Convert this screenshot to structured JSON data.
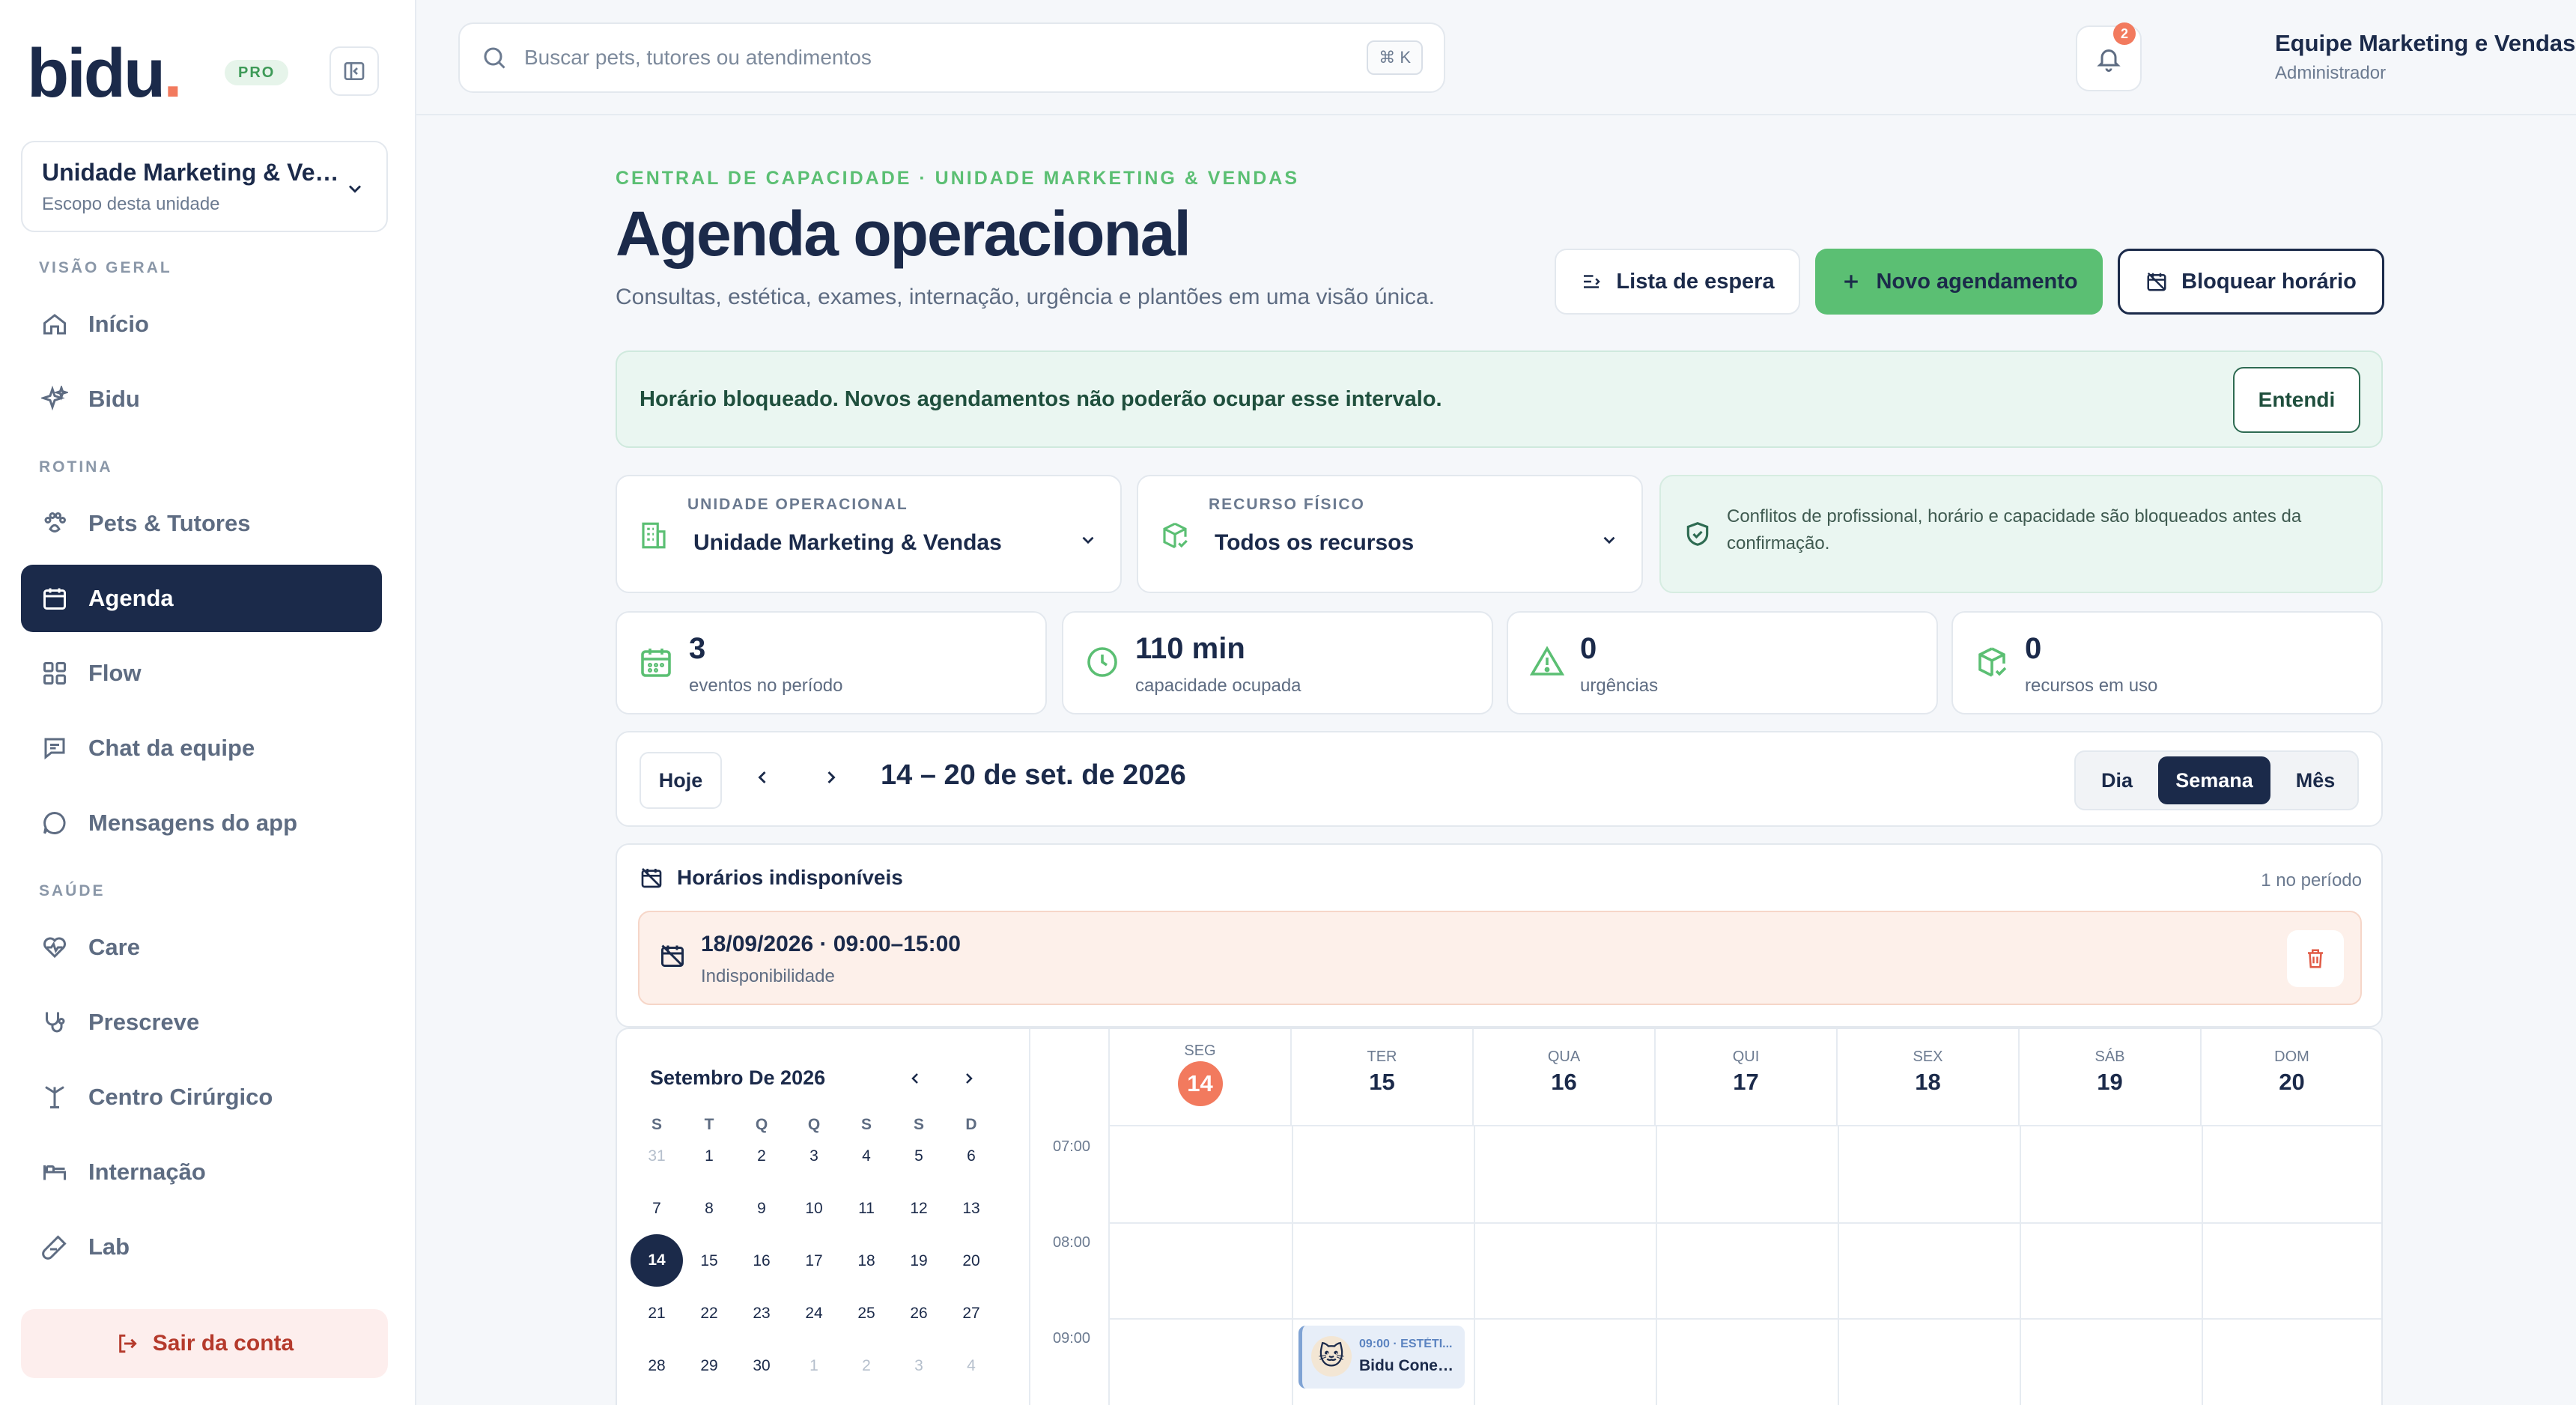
{
  "brand": {
    "logo_text": "bidu",
    "logo_dot": ".",
    "plan_badge": "PRO"
  },
  "sidebar": {
    "unit": {
      "name": "Unidade Marketing & Vendas",
      "scope": "Escopo desta unidade"
    },
    "sections": [
      {
        "label": "VISÃO GERAL",
        "items": [
          {
            "label": "Início",
            "icon": "home-icon"
          },
          {
            "label": "Bidu",
            "icon": "sparkles-icon"
          }
        ]
      },
      {
        "label": "ROTINA",
        "items": [
          {
            "label": "Pets & Tutores",
            "icon": "paw-icon"
          },
          {
            "label": "Agenda",
            "icon": "calendar-icon",
            "active": true
          },
          {
            "label": "Flow",
            "icon": "grid-icon"
          },
          {
            "label": "Chat da equipe",
            "icon": "chat-icon"
          },
          {
            "label": "Mensagens do app",
            "icon": "message-icon"
          }
        ]
      },
      {
        "label": "SAÚDE",
        "items": [
          {
            "label": "Care",
            "icon": "heart-pulse-icon"
          },
          {
            "label": "Prescreve",
            "icon": "stethoscope-icon"
          },
          {
            "label": "Centro Cirúrgico",
            "icon": "surgical-lamp-icon"
          },
          {
            "label": "Internação",
            "icon": "bed-icon"
          },
          {
            "label": "Lab",
            "icon": "test-tube-icon"
          }
        ]
      }
    ],
    "logout_label": "Sair da conta"
  },
  "topbar": {
    "search_placeholder": "Buscar pets, tutores ou atendimentos",
    "shortcut": "⌘ K",
    "notification_count": "2",
    "user_name": "Equipe Marketing e Vendas",
    "user_role": "Administrador"
  },
  "page": {
    "eyebrow": "CENTRAL DE CAPACIDADE · UNIDADE MARKETING & VENDAS",
    "title": "Agenda operacional",
    "subtitle": "Consultas, estética, exames, internação, urgência e plantões em uma visão única.",
    "actions": {
      "waitlist": "Lista de espera",
      "new": "Novo agendamento",
      "block": "Bloquear horário"
    },
    "alert": {
      "text": "Horário bloqueado. Novos agendamentos não poderão ocupar esse intervalo.",
      "button": "Entendi"
    },
    "filters": {
      "unit": {
        "label": "UNIDADE OPERACIONAL",
        "value": "Unidade Marketing & Vendas"
      },
      "resource": {
        "label": "RECURSO FÍSICO",
        "value": "Todos os recursos"
      },
      "conflict_note": "Conflitos de profissional, horário e capacidade são bloqueados antes da confirmação."
    },
    "stats": [
      {
        "value": "3",
        "label": "eventos no período",
        "icon": "calendar-icon"
      },
      {
        "value": "110 min",
        "label": "capacidade ocupada",
        "icon": "clock-icon"
      },
      {
        "value": "0",
        "label": "urgências",
        "icon": "warning-icon"
      },
      {
        "value": "0",
        "label": "recursos em uso",
        "icon": "box-icon"
      }
    ],
    "calendar_nav": {
      "today": "Hoje",
      "range": "14 – 20 de set. de 2026",
      "views": [
        "Dia",
        "Semana",
        "Mês"
      ],
      "active_view": "Semana"
    },
    "unavailable": {
      "title": "Horários indisponíveis",
      "count": "1 no período",
      "items": [
        {
          "title": "18/09/2026 · 09:00–15:00",
          "subtitle": "Indisponibilidade"
        }
      ]
    },
    "mini_calendar": {
      "title": "Setembro De 2026",
      "weekdays": [
        "S",
        "T",
        "Q",
        "Q",
        "S",
        "S",
        "D"
      ],
      "weeks": [
        [
          "31",
          "1",
          "2",
          "3",
          "4",
          "5",
          "6"
        ],
        [
          "7",
          "8",
          "9",
          "10",
          "11",
          "12",
          "13"
        ],
        [
          "14",
          "15",
          "16",
          "17",
          "18",
          "19",
          "20"
        ],
        [
          "21",
          "22",
          "23",
          "24",
          "25",
          "26",
          "27"
        ],
        [
          "28",
          "29",
          "30",
          "1",
          "2",
          "3",
          "4"
        ]
      ],
      "selected": "14"
    },
    "week": {
      "days": [
        {
          "name": "SEG",
          "num": "14",
          "today": true
        },
        {
          "name": "TER",
          "num": "15"
        },
        {
          "name": "QUA",
          "num": "16"
        },
        {
          "name": "QUI",
          "num": "17"
        },
        {
          "name": "SEX",
          "num": "18"
        },
        {
          "name": "SÁB",
          "num": "19"
        },
        {
          "name": "DOM",
          "num": "20"
        }
      ],
      "hours": [
        "07:00",
        "08:00",
        "09:00"
      ],
      "event": {
        "time": "09:00 · ESTÉTI...",
        "name": "Bidu Conexã...",
        "avatar": "🐱"
      }
    }
  }
}
